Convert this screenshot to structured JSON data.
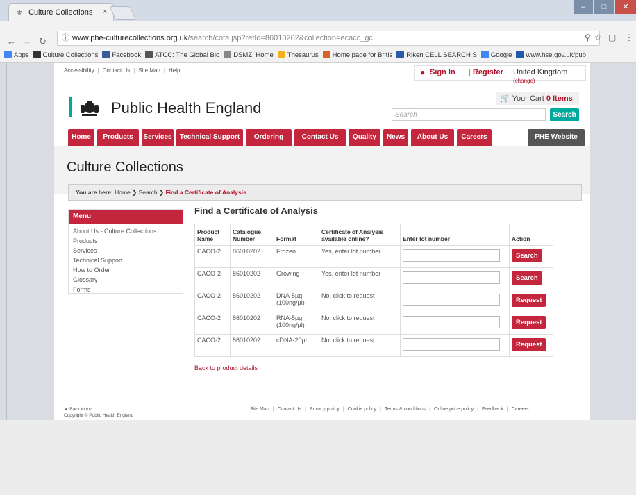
{
  "browser": {
    "tab_title": "Culture Collections",
    "tab_close": "×",
    "url_host": "www.phe-culturecollections.org.uk",
    "url_path": "/search/cofa.jsp?refId=86010202&collection=ecacc_gc",
    "bookmarks": [
      {
        "label": "Apps",
        "color": "#4285f4"
      },
      {
        "label": "Culture Collections",
        "color": "#333333"
      },
      {
        "label": "Facebook",
        "color": "#3b5998"
      },
      {
        "label": "ATCC: The Global Bio",
        "color": "#555555"
      },
      {
        "label": "DSMZ: Home",
        "color": "#888888"
      },
      {
        "label": "Thesaurus",
        "color": "#f2b21b"
      },
      {
        "label": "Home page for Britis",
        "color": "#d9602a"
      },
      {
        "label": "Riken CELL SEARCH S",
        "color": "#2b5aa6"
      },
      {
        "label": "Google",
        "color": "#4285f4"
      },
      {
        "label": "www.hse.gov.uk/pub",
        "color": "#1f5aa6"
      }
    ]
  },
  "header": {
    "util_links": [
      "Accessibility",
      "Contact Us",
      "Site Map",
      "Help"
    ],
    "sign_in": "Sign In",
    "register": "Register",
    "country": "United Kingdom",
    "change": "(change)",
    "org_name": "Public Health England",
    "cart_label": "Your Cart",
    "cart_count": "0 Items",
    "search_placeholder": "Search",
    "search_button": "Search",
    "nav": [
      "Home",
      "Products",
      "Services",
      "Technical Support",
      "Ordering",
      "Contact Us",
      "Quality",
      "News",
      "About Us",
      "Careers",
      "PHE Website"
    ]
  },
  "page": {
    "title": "Culture Collections",
    "breadcrumb_label": "You are here:",
    "breadcrumb_home": "Home",
    "breadcrumb_search": "Search",
    "breadcrumb_current": "Find a Certificate of Analysis"
  },
  "menu": {
    "heading": "Menu",
    "items": [
      "About Us - Culture Collections",
      "Products",
      "Services",
      "Technical Support",
      "How to Order",
      "Glossary",
      "Forms"
    ]
  },
  "cofa": {
    "heading": "Find a Certificate of Analysis",
    "columns": [
      "Product Name",
      "Catalogue Number",
      "Format",
      "Certificate of Analysis available online?",
      "Enter lot number",
      "Action"
    ],
    "rows": [
      {
        "product": "CACO-2",
        "catalogue": "86010202",
        "format": "Frozen",
        "available": "Yes, enter lot number",
        "action": "Search"
      },
      {
        "product": "CACO-2",
        "catalogue": "86010202",
        "format": "Growing",
        "available": "Yes, enter lot number",
        "action": "Search"
      },
      {
        "product": "CACO-2",
        "catalogue": "86010202",
        "format": "DNA-5µg (100ng/µl)",
        "available": "No, click to request",
        "action": "Request"
      },
      {
        "product": "CACO-2",
        "catalogue": "86010202",
        "format": "RNA-5µg (100ng/µl)",
        "available": "No, click to request",
        "action": "Request"
      },
      {
        "product": "CACO-2",
        "catalogue": "86010202",
        "format": "cDNA-20µl",
        "available": "No, click to request",
        "action": "Request"
      }
    ],
    "back_link": "Back to product details"
  },
  "footer": {
    "back_to_top": "Back to top",
    "copyright": "Copyright © Public Health England",
    "links": [
      "Site Map",
      "Contact Us",
      "Privacy policy",
      "Cookie policy",
      "Terms & conditions",
      "Online price policy",
      "Feedback",
      "Careers"
    ]
  }
}
